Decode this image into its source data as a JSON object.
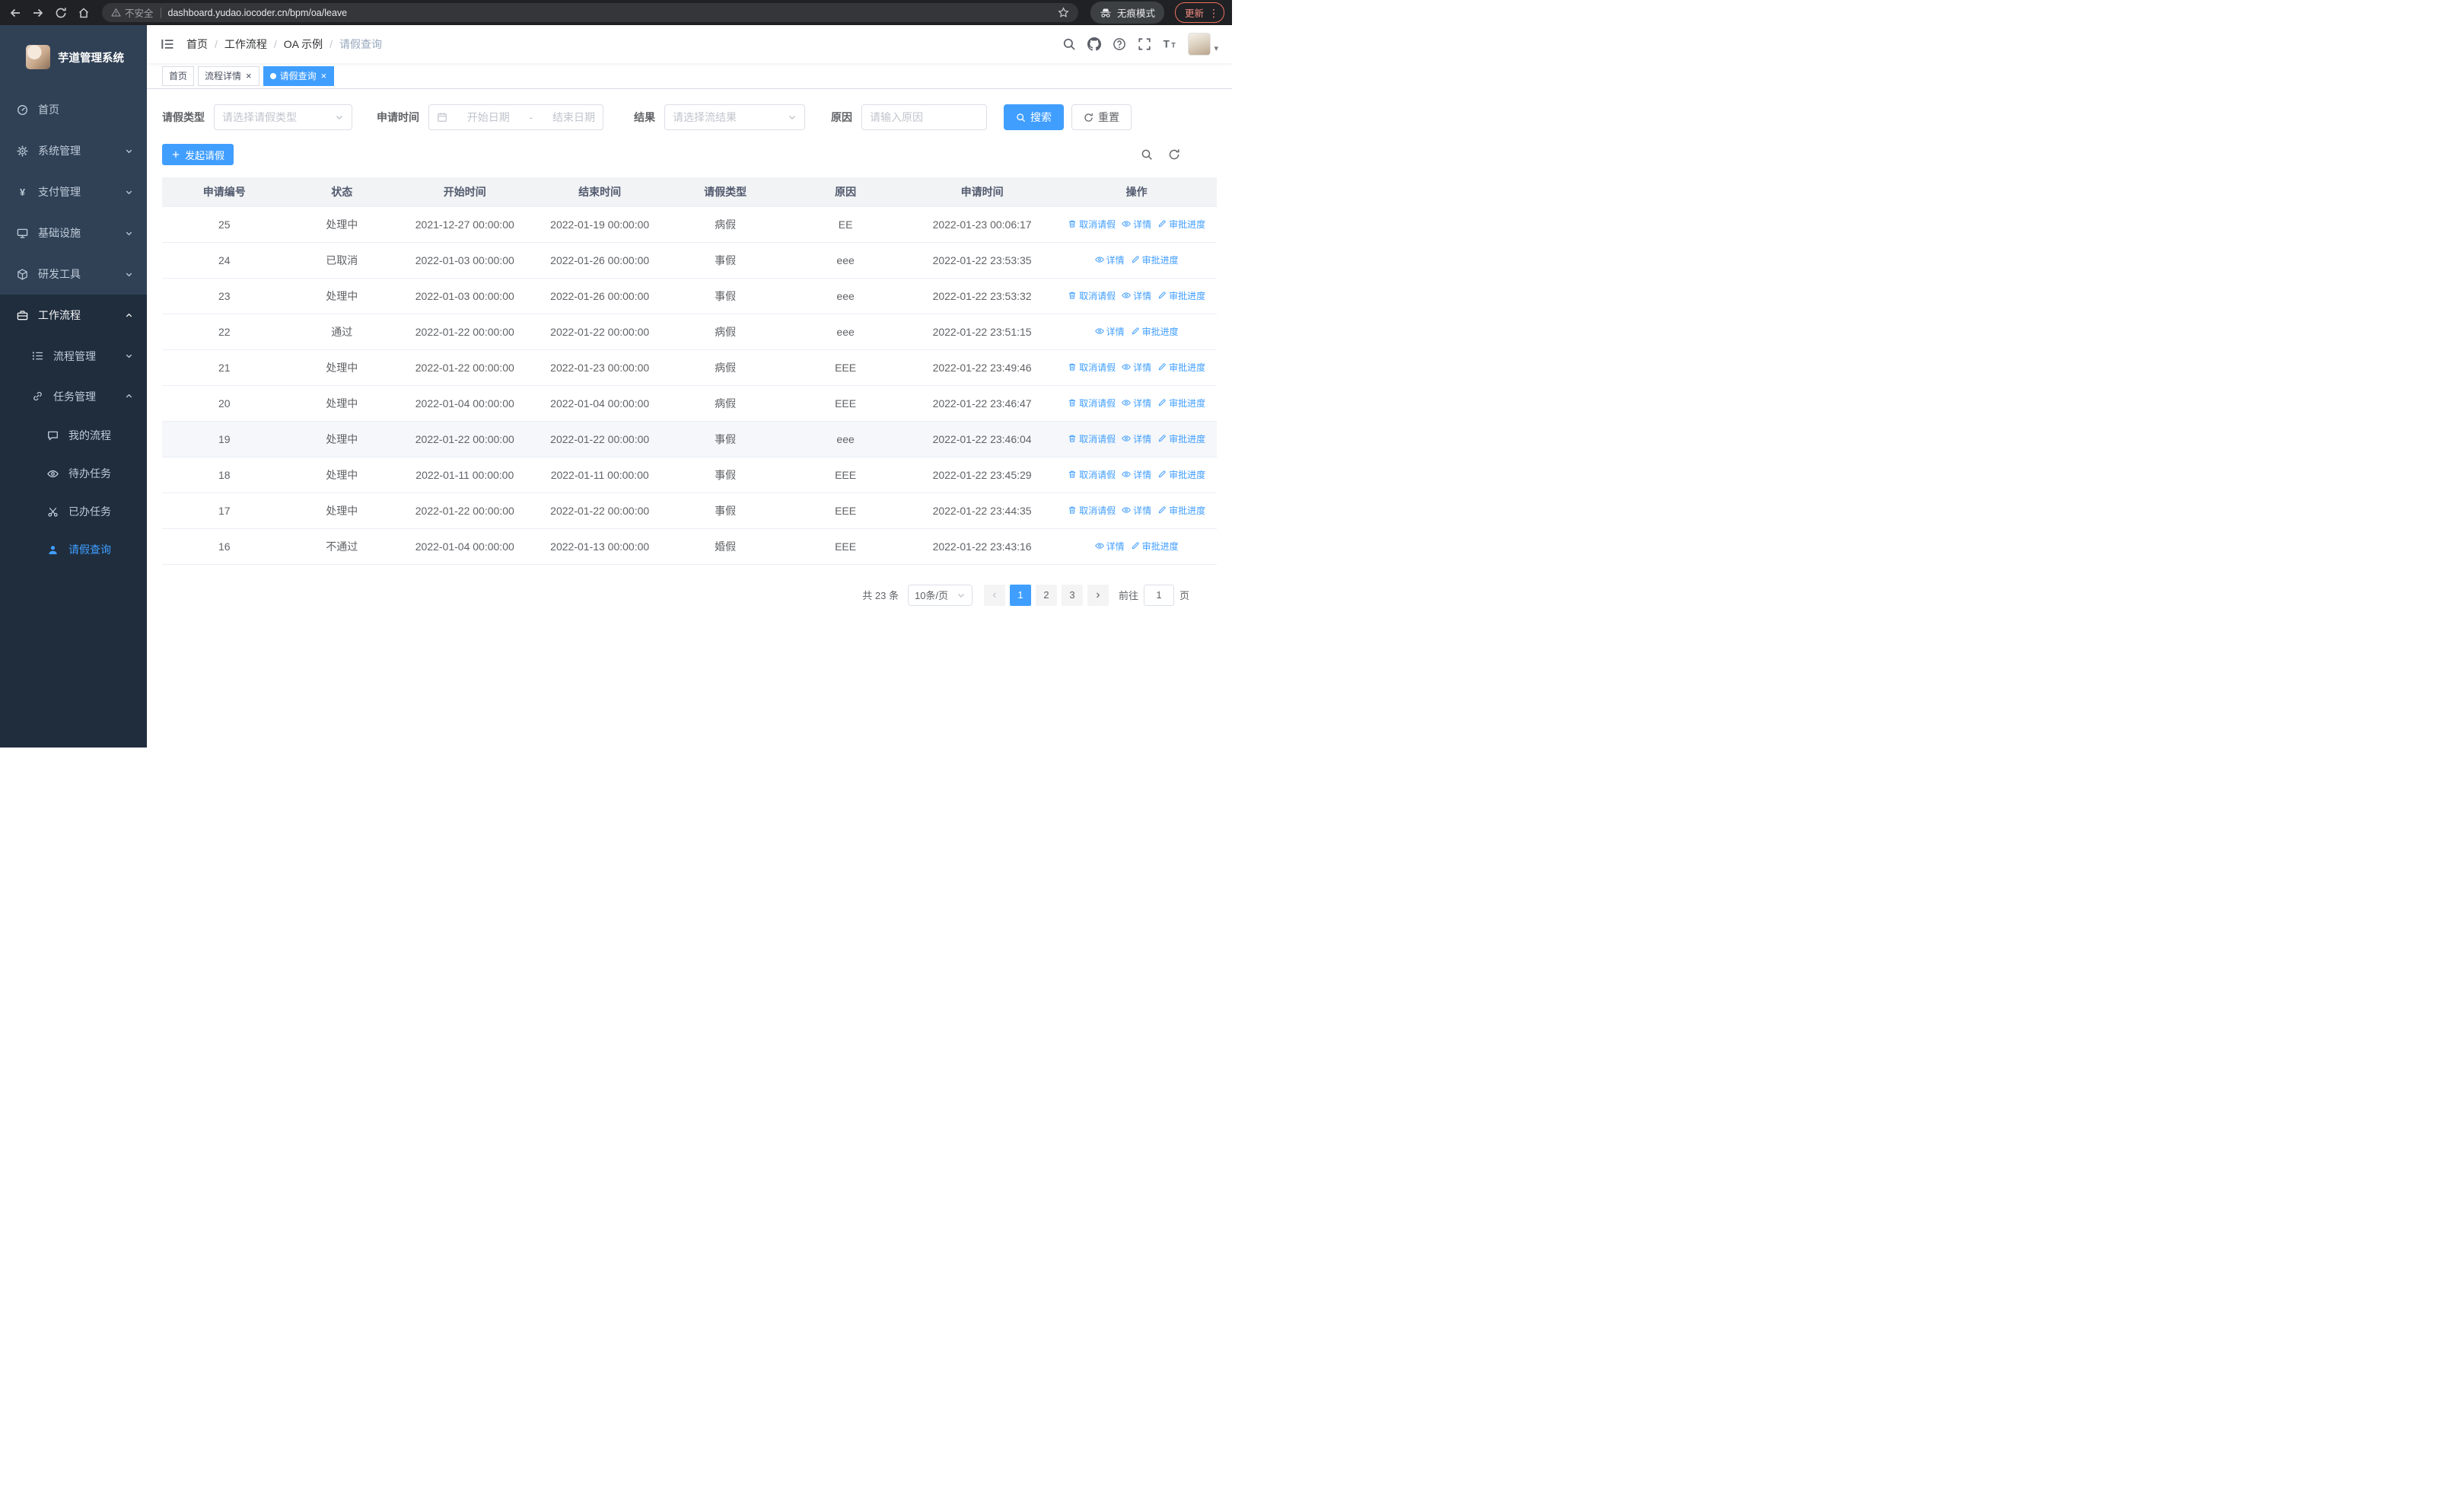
{
  "browser": {
    "security_label": "不安全",
    "url": "dashboard.yudao.iocoder.cn/bpm/oa/leave",
    "incognito_label": "无痕模式",
    "update_label": "更新"
  },
  "sidebar": {
    "logo_title": "芋道管理系统",
    "items": [
      {
        "key": "home",
        "label": "首页",
        "icon": "dashboard-icon",
        "level": 1,
        "section": "top"
      },
      {
        "key": "system",
        "label": "系统管理",
        "icon": "gear-icon",
        "level": 1,
        "chevron": "down",
        "section": "top"
      },
      {
        "key": "payment",
        "label": "支付管理",
        "icon": "yen-icon",
        "level": 1,
        "chevron": "down",
        "section": "top"
      },
      {
        "key": "infrastructure",
        "label": "基础设施",
        "icon": "infrastructure-icon",
        "level": 1,
        "chevron": "down",
        "section": "top"
      },
      {
        "key": "dev-tools",
        "label": "研发工具",
        "icon": "toolbox-icon",
        "level": 1,
        "chevron": "down",
        "section": "top"
      },
      {
        "key": "workflow",
        "label": "工作流程",
        "icon": "briefcase-icon",
        "level": 1,
        "chevron": "up",
        "section": "dark",
        "emphasis": true
      },
      {
        "key": "process-management",
        "label": "流程管理",
        "icon": "tree-list-icon",
        "level": 2,
        "chevron": "down",
        "section": "dark"
      },
      {
        "key": "task-management",
        "label": "任务管理",
        "icon": "link-icon",
        "level": 2,
        "chevron": "up",
        "section": "dark"
      },
      {
        "key": "my-process",
        "label": "我的流程",
        "icon": "message-icon",
        "level": 3,
        "section": "dark"
      },
      {
        "key": "todo-tasks",
        "label": "待办任务",
        "icon": "eye-icon",
        "level": 3,
        "section": "dark"
      },
      {
        "key": "done-tasks",
        "label": "已办任务",
        "icon": "scissors-icon",
        "level": 3,
        "section": "dark"
      },
      {
        "key": "leave-query",
        "label": "请假查询",
        "icon": "user-icon",
        "level": 3,
        "section": "dark",
        "active": true
      }
    ]
  },
  "header": {
    "breadcrumb": [
      "首页",
      "工作流程",
      "OA 示例",
      "请假查询"
    ]
  },
  "tabs": [
    {
      "label": "首页",
      "closable": false,
      "active": false
    },
    {
      "label": "流程详情",
      "closable": true,
      "active": false
    },
    {
      "label": "请假查询",
      "closable": true,
      "active": true
    }
  ],
  "filters": {
    "leave_type_label": "请假类型",
    "leave_type_placeholder": "请选择请假类型",
    "apply_time_label": "申请时间",
    "start_date_placeholder": "开始日期",
    "date_separator": "-",
    "end_date_placeholder": "结束日期",
    "result_label": "结果",
    "result_placeholder": "请选择流结果",
    "reason_label": "原因",
    "reason_placeholder": "请输入原因",
    "search_button": "搜索",
    "reset_button": "重置"
  },
  "toolbar": {
    "create_button": "发起请假"
  },
  "table": {
    "columns": [
      "申请编号",
      "状态",
      "开始时间",
      "结束时间",
      "请假类型",
      "原因",
      "申请时间",
      "操作"
    ],
    "actions": {
      "cancel": "取消请假",
      "detail": "详情",
      "progress": "审批进度"
    },
    "rows": [
      {
        "id": "25",
        "status": "处理中",
        "start": "2021-12-27 00:00:00",
        "end": "2022-01-19 00:00:00",
        "type": "病假",
        "reason": "EE",
        "applied": "2022-01-23 00:06:17",
        "ops": [
          "cancel",
          "detail",
          "progress"
        ]
      },
      {
        "id": "24",
        "status": "已取消",
        "start": "2022-01-03 00:00:00",
        "end": "2022-01-26 00:00:00",
        "type": "事假",
        "reason": "eee",
        "applied": "2022-01-22 23:53:35",
        "ops": [
          "detail",
          "progress"
        ]
      },
      {
        "id": "23",
        "status": "处理中",
        "start": "2022-01-03 00:00:00",
        "end": "2022-01-26 00:00:00",
        "type": "事假",
        "reason": "eee",
        "applied": "2022-01-22 23:53:32",
        "ops": [
          "cancel",
          "detail",
          "progress"
        ]
      },
      {
        "id": "22",
        "status": "通过",
        "start": "2022-01-22 00:00:00",
        "end": "2022-01-22 00:00:00",
        "type": "病假",
        "reason": "eee",
        "applied": "2022-01-22 23:51:15",
        "ops": [
          "detail",
          "progress"
        ]
      },
      {
        "id": "21",
        "status": "处理中",
        "start": "2022-01-22 00:00:00",
        "end": "2022-01-23 00:00:00",
        "type": "病假",
        "reason": "EEE",
        "applied": "2022-01-22 23:49:46",
        "ops": [
          "cancel",
          "detail",
          "progress"
        ]
      },
      {
        "id": "20",
        "status": "处理中",
        "start": "2022-01-04 00:00:00",
        "end": "2022-01-04 00:00:00",
        "type": "病假",
        "reason": "EEE",
        "applied": "2022-01-22 23:46:47",
        "ops": [
          "cancel",
          "detail",
          "progress"
        ]
      },
      {
        "id": "19",
        "status": "处理中",
        "start": "2022-01-22 00:00:00",
        "end": "2022-01-22 00:00:00",
        "type": "事假",
        "reason": "eee",
        "applied": "2022-01-22 23:46:04",
        "ops": [
          "cancel",
          "detail",
          "progress"
        ],
        "hover": true
      },
      {
        "id": "18",
        "status": "处理中",
        "start": "2022-01-11 00:00:00",
        "end": "2022-01-11 00:00:00",
        "type": "事假",
        "reason": "EEE",
        "applied": "2022-01-22 23:45:29",
        "ops": [
          "cancel",
          "detail",
          "progress"
        ]
      },
      {
        "id": "17",
        "status": "处理中",
        "start": "2022-01-22 00:00:00",
        "end": "2022-01-22 00:00:00",
        "type": "事假",
        "reason": "EEE",
        "applied": "2022-01-22 23:44:35",
        "ops": [
          "cancel",
          "detail",
          "progress"
        ]
      },
      {
        "id": "16",
        "status": "不通过",
        "start": "2022-01-04 00:00:00",
        "end": "2022-01-13 00:00:00",
        "type": "婚假",
        "reason": "EEE",
        "applied": "2022-01-22 23:43:16",
        "ops": [
          "detail",
          "progress"
        ]
      }
    ]
  },
  "pagination": {
    "total_text": "共 23 条",
    "page_size": "10条/页",
    "pages": [
      "1",
      "2",
      "3"
    ],
    "active_page": "1",
    "prev_symbol": "‹",
    "next_symbol": "›",
    "goto_label": "前往",
    "goto_value": "1",
    "goto_suffix": "页"
  },
  "colors": {
    "primary": "#409eff",
    "sidebar": "#304156",
    "sidebar_dark": "#1f2d3d"
  }
}
